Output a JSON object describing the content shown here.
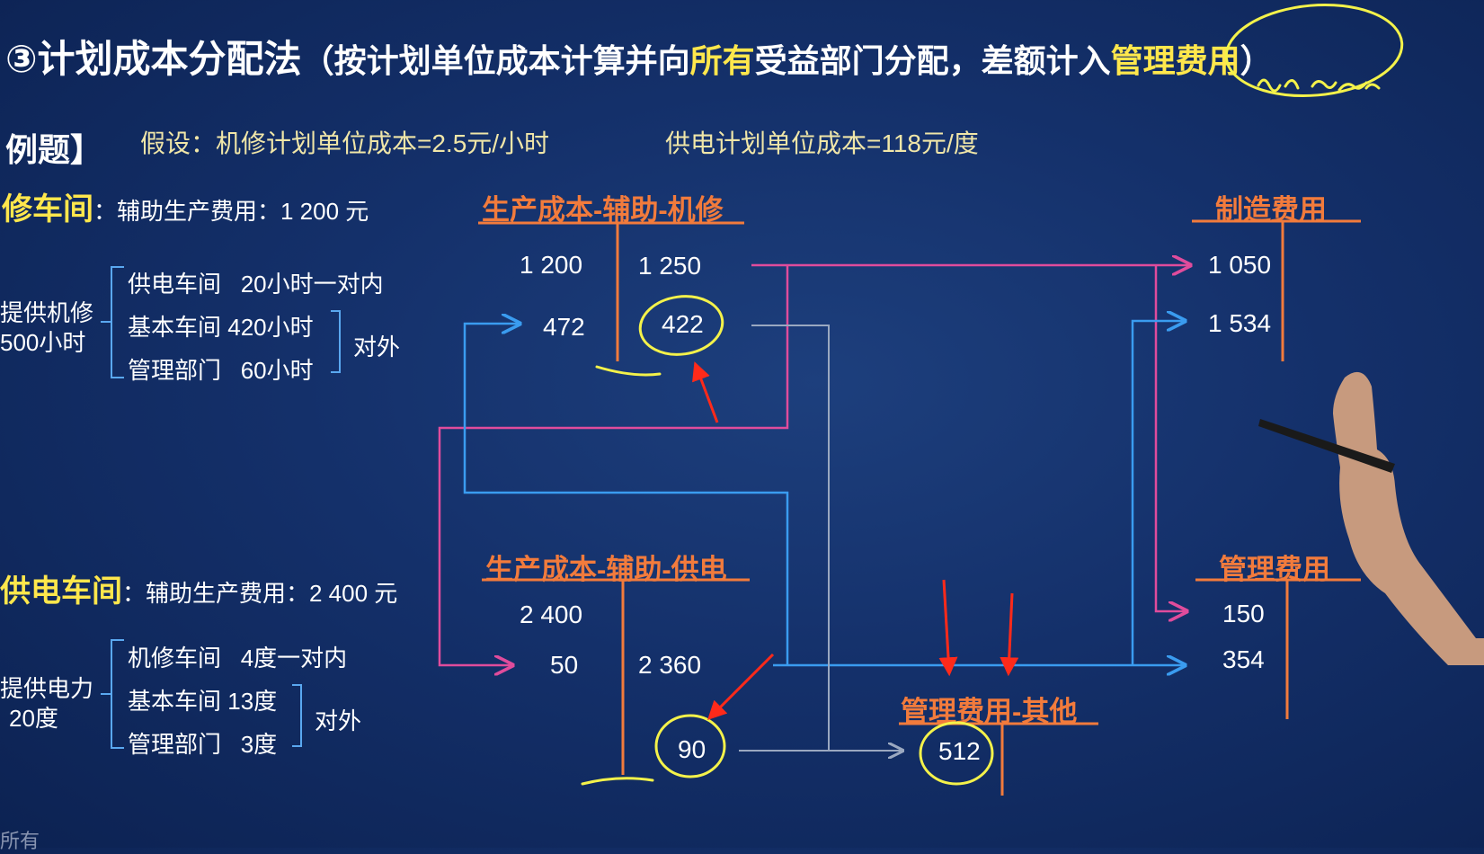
{
  "title": {
    "main": "③计划成本分配法",
    "paren_prefix": "（按计划单位成本计算并向",
    "paren_highlight": "所有",
    "paren_middle": "受益部门分配，差额计入",
    "paren_end": "管理费用",
    "paren_close": "）"
  },
  "example": {
    "label": "例题】",
    "assume_1": "假设：机修计划单位成本=2.5元/小时",
    "assume_2": "供电计划单位成本=118元/度"
  },
  "repair": {
    "heading": "修车间",
    "cost_label": "：辅助生产费用：1 200 元",
    "provide_1": "提供机修",
    "provide_2": "500小时",
    "items": [
      {
        "label": "供电车间",
        "value": "20小时",
        "note": "一对内"
      },
      {
        "label": "基本车间",
        "value": "420小时",
        "note": ""
      },
      {
        "label": "管理部门",
        "value": "60小时",
        "note": ""
      }
    ],
    "external": "对外"
  },
  "power": {
    "heading": "供电车间",
    "cost_label": "：辅助生产费用：2 400 元",
    "provide_1": "提供电力",
    "provide_2": "20度",
    "items": [
      {
        "label": "机修车间",
        "value": "4度",
        "note": "一对内"
      },
      {
        "label": "基本车间",
        "value": "13度",
        "note": ""
      },
      {
        "label": "管理部门",
        "value": "3度",
        "note": ""
      }
    ],
    "external": "对外"
  },
  "accounts": {
    "repair_aux": {
      "title": "生产成本-辅助-机修",
      "debit": [
        "1 200",
        "472"
      ],
      "credit": [
        "1 250",
        "422"
      ]
    },
    "power_aux": {
      "title": "生产成本-辅助-供电",
      "debit": [
        "2 400",
        "50"
      ],
      "credit": [
        "2 360",
        "90"
      ]
    },
    "manufacturing": {
      "title": "制造费用",
      "debit": [
        "1 050",
        "1 534"
      ]
    },
    "admin": {
      "title": "管理费用",
      "debit": [
        "150",
        "354"
      ]
    },
    "admin_other": {
      "title": "管理费用-其他",
      "debit": [
        "512"
      ]
    }
  },
  "footer_fragment": "所有",
  "colors": {
    "background": "#14306a",
    "account_title": "#f27b3c",
    "heading_yellow": "#ffe74c",
    "pink_line": "#e04c9c",
    "blue_line": "#3a9cf0",
    "gray_line": "#9aa8c0",
    "red_arrow": "#ff2a1a",
    "annotation": "#f4f24a"
  }
}
